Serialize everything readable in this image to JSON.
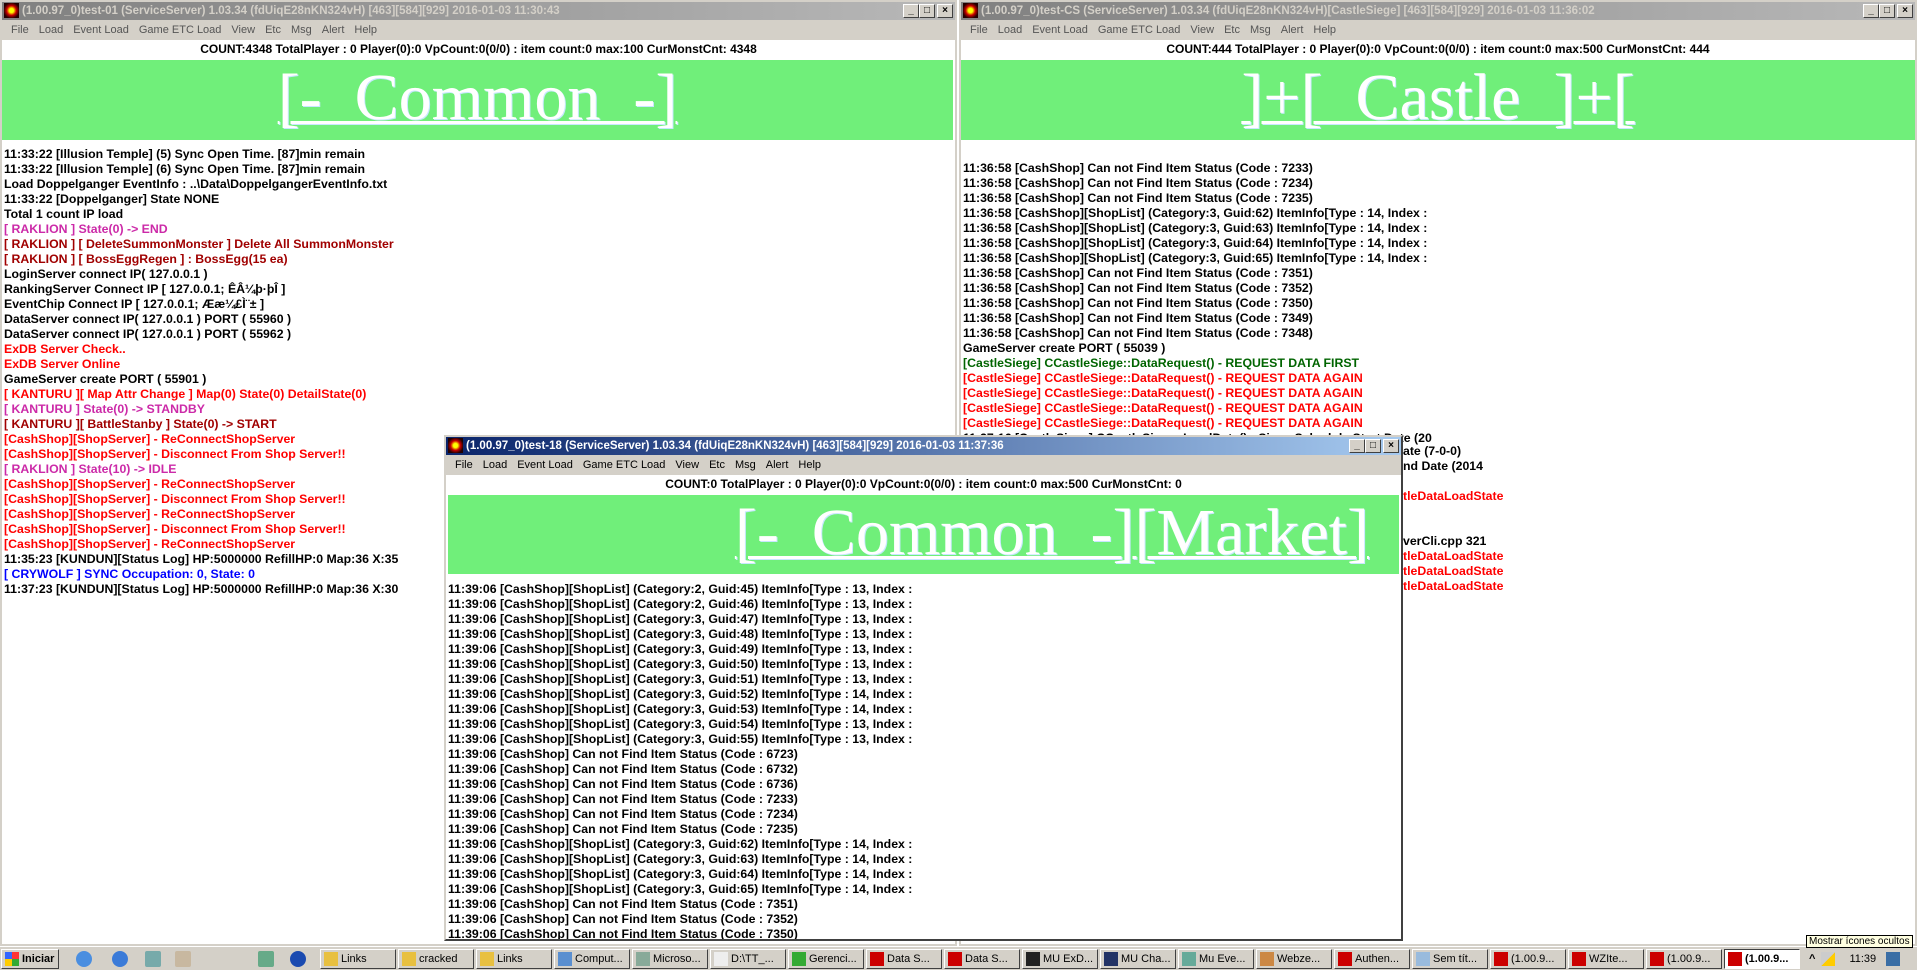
{
  "colors": {
    "banner_green": "#70ef7a",
    "black": "#000000",
    "magenta": "#cc2aa8",
    "dark_red": "#a00000",
    "red": "#ff0000",
    "green": "#006400",
    "blue": "#0000ff"
  },
  "menu": [
    "File",
    "Load",
    "Event Load",
    "Game ETC Load",
    "View",
    "Etc",
    "Msg",
    "Alert",
    "Help"
  ],
  "window_left": {
    "title": "(1.00.97_0)test-01 (ServiceServer) 1.03.34 (fdUiqE28nKN324vH) [463][584][929] 2016-01-03 11:30:43",
    "count": "COUNT:4348  TotalPlayer : 0  Player(0):0 VpCount:0(0/0) : item count:0 max:100 CurMonstCnt: 4348",
    "banner": "[-  Common  -]",
    "log": [
      {
        "t": "11:33:22 [Illusion Temple] (5) Sync Open Time. [87]min remain",
        "c": "#000000"
      },
      {
        "t": "11:33:22 [Illusion Temple] (6) Sync Open Time. [87]min remain",
        "c": "#000000"
      },
      {
        "t": "Load Doppelganger EventInfo : ..\\Data\\DoppelgangerEventInfo.txt",
        "c": "#000000"
      },
      {
        "t": "11:33:22 [Doppelganger] State NONE",
        "c": "#000000"
      },
      {
        "t": "Total 1 count IP load",
        "c": "#000000"
      },
      {
        "t": "[ RAKLION ] State(0) -> END",
        "c": "#cc2aa8"
      },
      {
        "t": "[ RAKLION ] [ DeleteSummonMonster ] Delete All SummonMonster",
        "c": "#a00000"
      },
      {
        "t": "[ RAKLION ] [ BossEggRegen ] : BossEgg(15 ea)",
        "c": "#a00000"
      },
      {
        "t": "LoginServer connect IP( 127.0.0.1 )",
        "c": "#000000"
      },
      {
        "t": "RankingServer Connect IP [ 127.0.0.1; ÊÂ¼þ·þÎ ]",
        "c": "#000000"
      },
      {
        "t": "EventChip Connect IP [ 127.0.0.1; Ææ¼£Ì¨± ]",
        "c": "#000000"
      },
      {
        "t": "DataServer connect IP( 127.0.0.1 ) PORT ( 55960 )",
        "c": "#000000"
      },
      {
        "t": "DataServer connect IP( 127.0.0.1 ) PORT ( 55962 )",
        "c": "#000000"
      },
      {
        "t": "ExDB Server Check..",
        "c": "#ff0000"
      },
      {
        "t": "ExDB Server Online",
        "c": "#ff0000"
      },
      {
        "t": "GameServer create PORT ( 55901 )",
        "c": "#000000"
      },
      {
        "t": "[ KANTURU ][ Map Attr Change ] Map(0) State(0) DetailState(0)",
        "c": "#ff0000"
      },
      {
        "t": "[ KANTURU ] State(0) -> STANDBY",
        "c": "#cc2aa8"
      },
      {
        "t": "[ KANTURU ][ BattleStanby ] State(0) -> START",
        "c": "#a00000"
      },
      {
        "t": "[CashShop][ShopServer] - ReConnectShopServer",
        "c": "#ff0000"
      },
      {
        "t": "[CashShop][ShopServer] - Disconnect From Shop Server!!",
        "c": "#ff0000"
      },
      {
        "t": "[ RAKLION ] State(10) -> IDLE",
        "c": "#cc2aa8"
      },
      {
        "t": "[CashShop][ShopServer] - ReConnectShopServer",
        "c": "#ff0000"
      },
      {
        "t": "[CashShop][ShopServer] - Disconnect From Shop Server!!",
        "c": "#ff0000"
      },
      {
        "t": "[CashShop][ShopServer] - ReConnectShopServer",
        "c": "#ff0000"
      },
      {
        "t": "[CashShop][ShopServer] - Disconnect From Shop Server!!",
        "c": "#ff0000"
      },
      {
        "t": "[CashShop][ShopServer] - ReConnectShopServer",
        "c": "#ff0000"
      },
      {
        "t": "11:35:23 [KUNDUN][Status Log] HP:5000000 RefillHP:0 Map:36 X:35",
        "c": "#000000"
      },
      {
        "t": "[ CRYWOLF ] SYNC Occupation: 0, State: 0",
        "c": "#0000ff"
      },
      {
        "t": "11:37:23 [KUNDUN][Status Log] HP:5000000 RefillHP:0 Map:36 X:30",
        "c": "#000000"
      }
    ]
  },
  "window_right": {
    "title": "(1.00.97_0)test-CS (ServiceServer) 1.03.34 (fdUiqE28nKN324vH)[CastleSiege] [463][584][929] 2016-01-03 11:36:02",
    "count": "COUNT:444  TotalPlayer : 0  Player(0):0 VpCount:0(0/0) : item count:0 max:500 CurMonstCnt: 444",
    "banner": "]+[  Castle  ]+[",
    "log": [
      {
        "t": "11:36:58 [CashShop] Can not Find Item Status (Code : 7233)",
        "c": "#000000"
      },
      {
        "t": "11:36:58 [CashShop] Can not Find Item Status (Code : 7234)",
        "c": "#000000"
      },
      {
        "t": "11:36:58 [CashShop] Can not Find Item Status (Code : 7235)",
        "c": "#000000"
      },
      {
        "t": "11:36:58 [CashShop][ShopList] (Category:3, Guid:62) ItemInfo[Type : 14, Index :",
        "c": "#000000"
      },
      {
        "t": "11:36:58 [CashShop][ShopList] (Category:3, Guid:63) ItemInfo[Type : 14, Index :",
        "c": "#000000"
      },
      {
        "t": "11:36:58 [CashShop][ShopList] (Category:3, Guid:64) ItemInfo[Type : 14, Index :",
        "c": "#000000"
      },
      {
        "t": "11:36:58 [CashShop][ShopList] (Category:3, Guid:65) ItemInfo[Type : 14, Index :",
        "c": "#000000"
      },
      {
        "t": "11:36:58 [CashShop] Can not Find Item Status (Code : 7351)",
        "c": "#000000"
      },
      {
        "t": "11:36:58 [CashShop] Can not Find Item Status (Code : 7352)",
        "c": "#000000"
      },
      {
        "t": "11:36:58 [CashShop] Can not Find Item Status (Code : 7350)",
        "c": "#000000"
      },
      {
        "t": "11:36:58 [CashShop] Can not Find Item Status (Code : 7349)",
        "c": "#000000"
      },
      {
        "t": "11:36:58 [CashShop] Can not Find Item Status (Code : 7348)",
        "c": "#000000"
      },
      {
        "t": "GameServer create PORT ( 55039 )",
        "c": "#000000"
      },
      {
        "t": "[CastleSiege] CCastleSiege::DataRequest() - REQUEST DATA FIRST",
        "c": "#006400"
      },
      {
        "t": "[CastleSiege] CCastleSiege::DataRequest() - REQUEST DATA AGAIN",
        "c": "#ff0000"
      },
      {
        "t": "[CastleSiege] CCastleSiege::DataRequest() - REQUEST DATA AGAIN",
        "c": "#ff0000"
      },
      {
        "t": "[CastleSiege] CCastleSiege::DataRequest() - REQUEST DATA AGAIN",
        "c": "#ff0000"
      },
      {
        "t": "[CastleSiege] CCastleSiege::DataRequest() - REQUEST DATA AGAIN",
        "c": "#ff0000"
      },
      {
        "t": "11:37:16 [CastleSiege] CCastleSiege::LoadData() - Siege Schedule Start Date (20",
        "c": "#000000"
      }
    ],
    "partial_lines": [
      {
        "t": "ate (7-0-0)",
        "c": "#000000"
      },
      {
        "t": "nd Date (2014",
        "c": "#000000"
      },
      {
        "t": "",
        "c": "#000000"
      },
      {
        "t": "tleDataLoadState",
        "c": "#ff0000"
      },
      {
        "t": "",
        "c": "#000000"
      },
      {
        "t": "",
        "c": "#000000"
      },
      {
        "t": "verCli.cpp 321",
        "c": "#000000"
      },
      {
        "t": "tleDataLoadState",
        "c": "#ff0000"
      },
      {
        "t": "tleDataLoadState",
        "c": "#ff0000"
      },
      {
        "t": "tleDataLoadState",
        "c": "#ff0000"
      }
    ]
  },
  "window_center": {
    "title": "(1.00.97_0)test-18 (ServiceServer) 1.03.34 (fdUiqE28nKN324vH) [463][584][929] 2016-01-03 11:37:36",
    "count": "COUNT:0  TotalPlayer : 0  Player(0):0 VpCount:0(0/0) : item count:0 max:500 CurMonstCnt: 0",
    "banner": "[-  Common  -][Market]",
    "log": [
      {
        "t": "11:39:06 [CashShop][ShopList] (Category:2, Guid:45) ItemInfo[Type : 13, Index :",
        "c": "#000000"
      },
      {
        "t": "11:39:06 [CashShop][ShopList] (Category:2, Guid:46) ItemInfo[Type : 13, Index :",
        "c": "#000000"
      },
      {
        "t": "11:39:06 [CashShop][ShopList] (Category:3, Guid:47) ItemInfo[Type : 13, Index :",
        "c": "#000000"
      },
      {
        "t": "11:39:06 [CashShop][ShopList] (Category:3, Guid:48) ItemInfo[Type : 13, Index :",
        "c": "#000000"
      },
      {
        "t": "11:39:06 [CashShop][ShopList] (Category:3, Guid:49) ItemInfo[Type : 13, Index :",
        "c": "#000000"
      },
      {
        "t": "11:39:06 [CashShop][ShopList] (Category:3, Guid:50) ItemInfo[Type : 13, Index :",
        "c": "#000000"
      },
      {
        "t": "11:39:06 [CashShop][ShopList] (Category:3, Guid:51) ItemInfo[Type : 13, Index :",
        "c": "#000000"
      },
      {
        "t": "11:39:06 [CashShop][ShopList] (Category:3, Guid:52) ItemInfo[Type : 14, Index :",
        "c": "#000000"
      },
      {
        "t": "11:39:06 [CashShop][ShopList] (Category:3, Guid:53) ItemInfo[Type : 14, Index :",
        "c": "#000000"
      },
      {
        "t": "11:39:06 [CashShop][ShopList] (Category:3, Guid:54) ItemInfo[Type : 13, Index :",
        "c": "#000000"
      },
      {
        "t": "11:39:06 [CashShop][ShopList] (Category:3, Guid:55) ItemInfo[Type : 13, Index :",
        "c": "#000000"
      },
      {
        "t": "11:39:06 [CashShop] Can not Find Item Status (Code : 6723)",
        "c": "#000000"
      },
      {
        "t": "11:39:06 [CashShop] Can not Find Item Status (Code : 6732)",
        "c": "#000000"
      },
      {
        "t": "11:39:06 [CashShop] Can not Find Item Status (Code : 6736)",
        "c": "#000000"
      },
      {
        "t": "11:39:06 [CashShop] Can not Find Item Status (Code : 7233)",
        "c": "#000000"
      },
      {
        "t": "11:39:06 [CashShop] Can not Find Item Status (Code : 7234)",
        "c": "#000000"
      },
      {
        "t": "11:39:06 [CashShop] Can not Find Item Status (Code : 7235)",
        "c": "#000000"
      },
      {
        "t": "11:39:06 [CashShop][ShopList] (Category:3, Guid:62) ItemInfo[Type : 14, Index :",
        "c": "#000000"
      },
      {
        "t": "11:39:06 [CashShop][ShopList] (Category:3, Guid:63) ItemInfo[Type : 14, Index :",
        "c": "#000000"
      },
      {
        "t": "11:39:06 [CashShop][ShopList] (Category:3, Guid:64) ItemInfo[Type : 14, Index :",
        "c": "#000000"
      },
      {
        "t": "11:39:06 [CashShop][ShopList] (Category:3, Guid:65) ItemInfo[Type : 14, Index :",
        "c": "#000000"
      },
      {
        "t": "11:39:06 [CashShop] Can not Find Item Status (Code : 7351)",
        "c": "#000000"
      },
      {
        "t": "11:39:06 [CashShop] Can not Find Item Status (Code : 7352)",
        "c": "#000000"
      },
      {
        "t": "11:39:06 [CashShop] Can not Find Item Status (Code : 7350)",
        "c": "#000000"
      }
    ]
  },
  "taskbar": {
    "start_label": "Iniciar",
    "buttons": [
      "Links",
      "cracked",
      "Links",
      "Comput...",
      "Microso...",
      "D:\\TT_...",
      "Gerenci...",
      "Data S...",
      "Data S...",
      "MU ExD...",
      "MU Cha...",
      "Mu Eve...",
      "Webze...",
      "Authen...",
      "Sem tít...",
      "(1.00.9...",
      "WZIte...",
      "(1.00.9...",
      "(1.00.9..."
    ],
    "active_index": 18,
    "clock": "11:39",
    "tooltip": "Mostrar ícones ocultos",
    "show_hidden_glyph": "^"
  }
}
